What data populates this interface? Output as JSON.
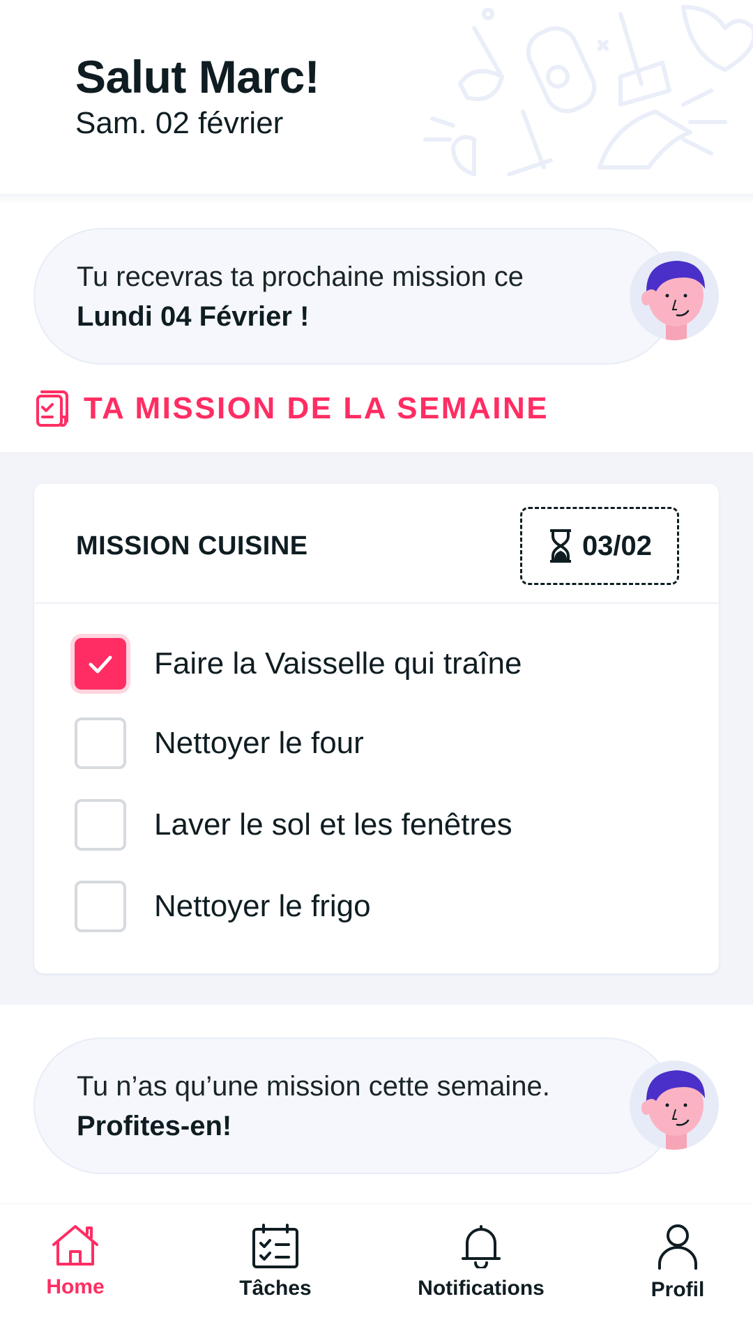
{
  "header": {
    "greeting": "Salut Marc!",
    "date": "Sam. 02 février"
  },
  "next_mission_message": {
    "text": "Tu recevras ta prochaine mission ce",
    "emphasis": "Lundi 04 Février !"
  },
  "section": {
    "title": "TA MISSION DE LA SEMAINE",
    "icon": "checklist-document-icon"
  },
  "mission": {
    "title": "MISSION CUISINE",
    "deadline": "03/02",
    "deadline_icon": "hourglass-icon",
    "tasks": [
      {
        "label": "Faire la Vaisselle qui traîne",
        "checked": true
      },
      {
        "label": "Nettoyer le four",
        "checked": false
      },
      {
        "label": "Laver le sol et les fenêtres",
        "checked": false
      },
      {
        "label": "Nettoyer le frigo",
        "checked": false
      }
    ]
  },
  "summary_message": {
    "text": "Tu n’as qu’une mission cette semaine.",
    "emphasis": "Profites-en!"
  },
  "nav": {
    "items": [
      {
        "label": "Home",
        "icon": "home-icon",
        "active": true
      },
      {
        "label": "Tâches",
        "icon": "task-list-icon",
        "active": false
      },
      {
        "label": "Notifications",
        "icon": "bell-icon",
        "active": false
      },
      {
        "label": "Profil",
        "icon": "user-icon",
        "active": false
      }
    ]
  },
  "colors": {
    "accent": "#ff2d63",
    "text": "#0f1d22",
    "bubble_bg": "#f5f7fc",
    "section_bg": "#f2f4fa"
  }
}
